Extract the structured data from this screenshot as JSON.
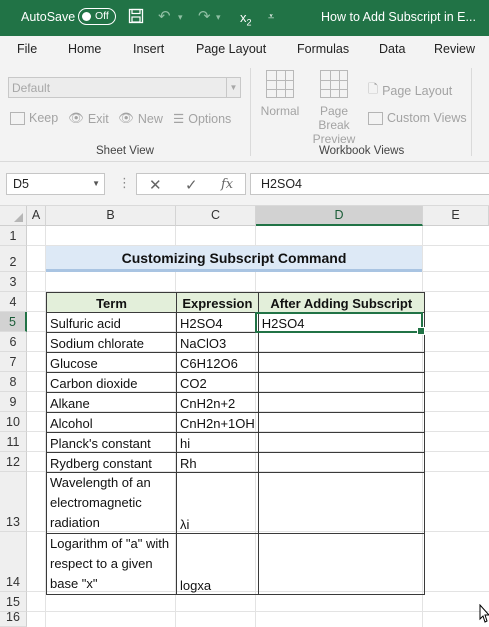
{
  "titlebar": {
    "autosave_label": "AutoSave",
    "autosave_state": "Off",
    "subscript_btn": "x",
    "subscript_sub": "2",
    "doc_title": "How to Add Subscript in E..."
  },
  "tabs": [
    "File",
    "Home",
    "Insert",
    "Page Layout",
    "Formulas",
    "Data",
    "Review"
  ],
  "ribbon": {
    "sheet_view_dropdown": "Default",
    "keep": "Keep",
    "exit": "Exit",
    "new": "New",
    "options": "Options",
    "sheet_view_group": "Sheet View",
    "normal": "Normal",
    "page_break_line1": "Page Break",
    "page_break_line2": "Preview",
    "page_layout": "Page Layout",
    "custom_views": "Custom Views",
    "workbook_views_group": "Workbook Views"
  },
  "formula_bar": {
    "name_box": "D5",
    "cancel": "✕",
    "enter": "✓",
    "fx": "fx",
    "value": "H2SO4"
  },
  "grid": {
    "columns": [
      "A",
      "B",
      "C",
      "D",
      "E"
    ],
    "rows": [
      "1",
      "2",
      "3",
      "4",
      "5",
      "6",
      "7",
      "8",
      "9",
      "10",
      "11",
      "12",
      "13",
      "14",
      "15",
      "16"
    ],
    "title": "Customizing Subscript Command",
    "headers": [
      "Term",
      "Expression",
      "After Adding Subscript"
    ],
    "data": [
      [
        "Sulfuric acid",
        "H2SO4",
        "H2SO4"
      ],
      [
        "Sodium chlorate",
        "NaClO3",
        ""
      ],
      [
        "Glucose",
        "C6H12O6",
        ""
      ],
      [
        "Carbon dioxide",
        "CO2",
        ""
      ],
      [
        "Alkane",
        "CnH2n+2",
        ""
      ],
      [
        "Alcohol",
        "CnH2n+1OH",
        ""
      ],
      [
        "Planck's constant",
        "hi",
        ""
      ],
      [
        "Rydberg constant",
        "Rh",
        ""
      ],
      [
        "Wavelength of an electromagnetic radiation",
        "λi",
        ""
      ],
      [
        "Logarithm of \"a\" with respect to a given base \"x\"",
        "logxa",
        ""
      ]
    ]
  },
  "colors": {
    "accent": "#217346",
    "title_fill": "#dde9f6",
    "header_fill": "#e3efda"
  }
}
